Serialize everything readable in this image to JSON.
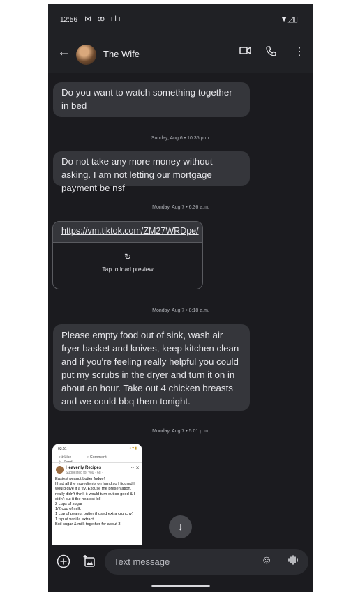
{
  "status_bar": {
    "time": "12:56",
    "left_icons": "⋈ ꝏ ılı",
    "right_icons": "▼◿▯"
  },
  "header": {
    "title": "The Wife",
    "back_icon": "arrow-left",
    "video_icon": "video-camera",
    "call_icon": "phone",
    "more_icon": "more-vertical"
  },
  "messages": {
    "m1": "Do you want to watch something together in bed",
    "ts1": "Sunday, Aug 6 • 10:35 p.m.",
    "m2": "Do not take any more money without asking. I am not letting our mortgage payment be nsf",
    "ts2": "Monday, Aug 7 • 6:36 a.m.",
    "link_url": "https://vm.tiktok.com/ZM27WRDpe/",
    "link_preview_label": "Tap to load preview",
    "ts3": "Monday, Aug 7 • 8:18 a.m.",
    "m3": "Please empty food out of sink, wash air fryer basket and knives, keep kitchen clean and if you're feeling really helpful you could put my scrubs in the dryer and turn it on in about an hour. Take out 4 chicken breasts and we could bbq them tonight.",
    "ts4": "Monday, Aug 7 • 5:01 p.m."
  },
  "image_thumb": {
    "time": "03:51",
    "like": "Like",
    "comment": "Comment",
    "send": "Send",
    "page_name": "Heavenly Recipes",
    "subline": "Suggested for you · 6d · ",
    "body": "Easiest peanut butter fudge!\nI had all the ingredients on hand so I figured I would give it a try. Excuse the presentation, I really didn't think it would turn out so good & I didn't cut it the neatest lol!\n2 cups of sugar\n1/2 cup of milk\n1 cup of peanut butter (I used extra crunchy)\n1 tsp of vanilla extract\nBoil sugar & milk together for about 3"
  },
  "composer": {
    "placeholder": "Text message",
    "add_icon": "plus-circle",
    "gallery_icon": "gallery-add",
    "emoji_icon": "emoji",
    "voice_icon": "voice-waveform"
  },
  "colors": {
    "background": "#1b1b1f",
    "bubble": "#35363b",
    "appbar": "#202125"
  }
}
